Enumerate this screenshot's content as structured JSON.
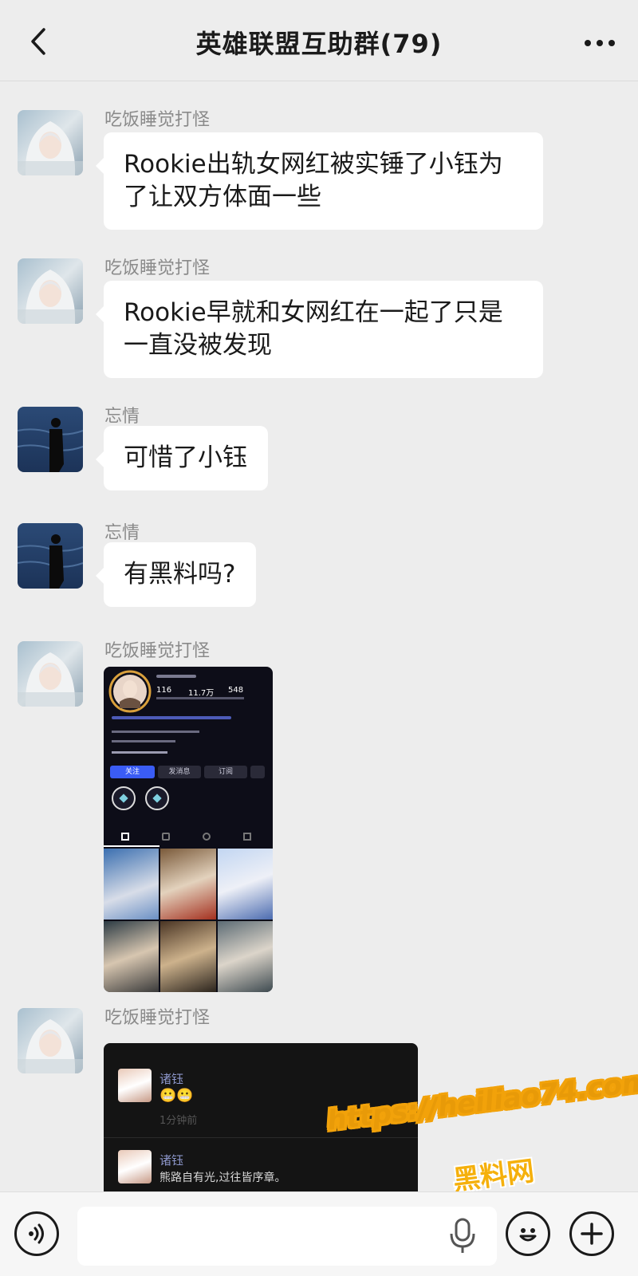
{
  "header": {
    "title": "英雄联盟互助群(79)",
    "back_icon": "chevron-left-icon",
    "more_icon": "more-dots-icon"
  },
  "messages": [
    {
      "sender": "吃饭睡觉打怪",
      "type": "text",
      "text_lines": [
        "Rookie出轨女网红被实锤了小钰为",
        "了让双方体面一些"
      ]
    },
    {
      "sender": "吃饭睡觉打怪",
      "type": "text",
      "text_lines": [
        "Rookie早就和女网红在一起了只是",
        "一直没被发现"
      ]
    },
    {
      "sender": "忘情",
      "type": "text",
      "text_lines": [
        "可惜了小钰"
      ]
    },
    {
      "sender": "忘情",
      "type": "text",
      "text_lines": [
        "有黑料吗?"
      ]
    },
    {
      "sender": "吃饭睡觉打怪",
      "type": "image",
      "profile": {
        "stats": [
          "116",
          "11.7万",
          "548"
        ],
        "buttons": [
          "关注",
          "发消息",
          "订阅"
        ]
      }
    },
    {
      "sender": "吃饭睡觉打怪",
      "type": "image",
      "comments": [
        {
          "name": "诸钰",
          "text": "😬😬",
          "meta": "1分钟前"
        },
        {
          "name": "诸钰",
          "text": "熊路自有光,过往皆序章。"
        }
      ]
    }
  ],
  "input_bar": {
    "voice_icon": "voice-wave-icon",
    "mic_icon": "microphone-icon",
    "emoji_icon": "smiley-icon",
    "plus_icon": "plus-icon"
  },
  "watermark": {
    "url": "https://heiliao74.com",
    "site": "黑料网"
  },
  "colors": {
    "background": "#ededed",
    "bubble": "#ffffff",
    "sender": "#8a8a8a",
    "watermark_orange": "#f2a20a"
  }
}
